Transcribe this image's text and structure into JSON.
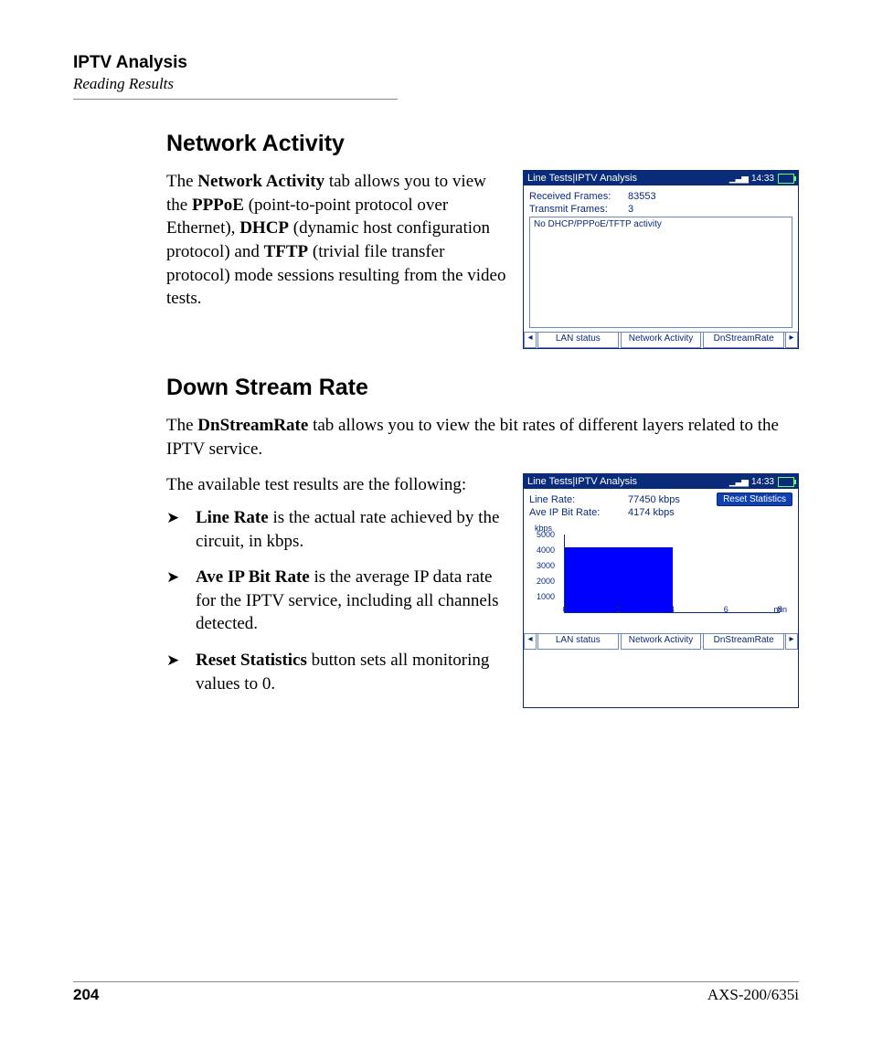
{
  "header": {
    "title": "IPTV Analysis",
    "subtitle": "Reading Results"
  },
  "section1": {
    "heading": "Network Activity",
    "para_pre": "The ",
    "b1": "Network Activity",
    "t1": " tab allows you to view the ",
    "b2": "PPPoE",
    "t2": " (point-to-point protocol over Ethernet), ",
    "b3": "DHCP",
    "t3": " (dynamic host configuration protocol) and ",
    "b4": "TFTP",
    "t4": " (trivial file transfer protocol) mode sessions resulting from the video tests."
  },
  "fig1": {
    "title": "Line Tests|IPTV Analysis",
    "time": "14:33",
    "rows": [
      {
        "k": "Received Frames:",
        "v": "83553"
      },
      {
        "k": "Transmit Frames:",
        "v": "3"
      }
    ],
    "boxmsg": "No DHCP/PPPoE/TFTP activity",
    "tabs": [
      "LAN status",
      "Network Activity",
      "DnStreamRate"
    ]
  },
  "section2": {
    "heading": "Down Stream Rate",
    "p1a": "The ",
    "p1b": "DnStreamRate",
    "p1c": " tab allows you to view the bit rates of different layers related to the IPTV service.",
    "p2": "The available test results are the following:",
    "items": [
      {
        "b": "Line Rate",
        "t": " is the actual rate achieved by the circuit, in kbps."
      },
      {
        "b": "Ave IP Bit Rate",
        "t": " is the average IP data rate for the IPTV service, including all channels detected."
      },
      {
        "b": "Reset Statistics",
        "t": " button sets all monitoring values to 0."
      }
    ]
  },
  "fig2": {
    "title": "Line Tests|IPTV Analysis",
    "time": "14:33",
    "rows": [
      {
        "k": "Line Rate:",
        "v": "77450 kbps"
      },
      {
        "k": "Ave IP Bit Rate:",
        "v": "4174 kbps"
      }
    ],
    "btn": "Reset Statistics",
    "tabs": [
      "LAN status",
      "Network Activity",
      "DnStreamRate"
    ]
  },
  "chart_data": {
    "type": "bar",
    "ylabel": "kbps",
    "xlabel": "min",
    "yticks": [
      1000,
      2000,
      3000,
      4000,
      5000
    ],
    "xticks": [
      0,
      2,
      4,
      6,
      8
    ],
    "ylim": [
      0,
      5000
    ],
    "xlim": [
      0,
      8
    ],
    "bar": {
      "x_start": 0,
      "x_end": 4,
      "value": 4174
    }
  },
  "footer": {
    "page": "204",
    "doc": "AXS-200/635i"
  }
}
